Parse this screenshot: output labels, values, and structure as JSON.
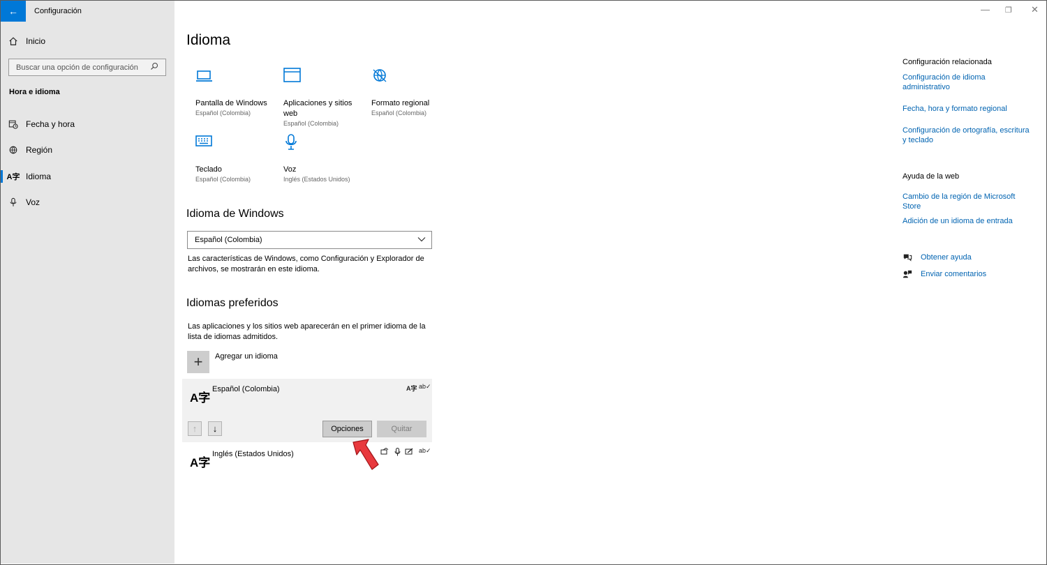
{
  "window": {
    "title": "Configuración",
    "controls": [
      "—",
      "❐",
      "✕"
    ]
  },
  "sidebar": {
    "home": "Inicio",
    "search_placeholder": "Buscar una opción de configuración",
    "section": "Hora e idioma",
    "items": [
      {
        "label": "Fecha y hora",
        "icon": "calendar-clock-icon"
      },
      {
        "label": "Región",
        "icon": "globe-icon"
      },
      {
        "label": "Idioma",
        "icon": "language-icon",
        "active": true
      },
      {
        "label": "Voz",
        "icon": "microphone-icon"
      }
    ]
  },
  "main": {
    "title": "Idioma",
    "tiles": [
      {
        "label": "Pantalla de Windows",
        "sub": "Español (Colombia)"
      },
      {
        "label": "Aplicaciones y sitios web",
        "sub": "Español (Colombia)"
      },
      {
        "label": "Formato regional",
        "sub": "Español (Colombia)"
      },
      {
        "label": "Teclado",
        "sub": "Español (Colombia)"
      },
      {
        "label": "Voz",
        "sub": "Inglés (Estados Unidos)"
      }
    ],
    "windows_language": {
      "heading": "Idioma de Windows",
      "selected": "Español (Colombia)",
      "description": "Las características de Windows, como Configuración y Explorador de archivos, se mostrarán en este idioma."
    },
    "preferred": {
      "heading": "Idiomas preferidos",
      "description": "Las aplicaciones y los sitios web aparecerán en el primer idioma de la lista de idiomas admitidos.",
      "add_label": "Agregar un idioma",
      "languages": [
        {
          "name": "Español (Colombia)"
        },
        {
          "name": "Inglés (Estados Unidos)"
        }
      ],
      "options_button": "Opciones",
      "remove_button": "Quitar"
    }
  },
  "right_panel": {
    "related_heading": "Configuración relacionada",
    "related_links": [
      "Configuración de idioma administrativo",
      "Fecha, hora y formato regional",
      "Configuración de ortografía, escritura y teclado"
    ],
    "web_help_heading": "Ayuda de la web",
    "web_help_links": [
      "Cambio de la región de Microsoft Store",
      "Adición de un idioma de entrada"
    ],
    "get_help": "Obtener ayuda",
    "feedback": "Enviar comentarios"
  },
  "colors": {
    "accent": "#0078d7",
    "link": "#0063b1",
    "sidebar_bg": "#e6e6e6",
    "annotation_arrow": "#e8393d"
  }
}
